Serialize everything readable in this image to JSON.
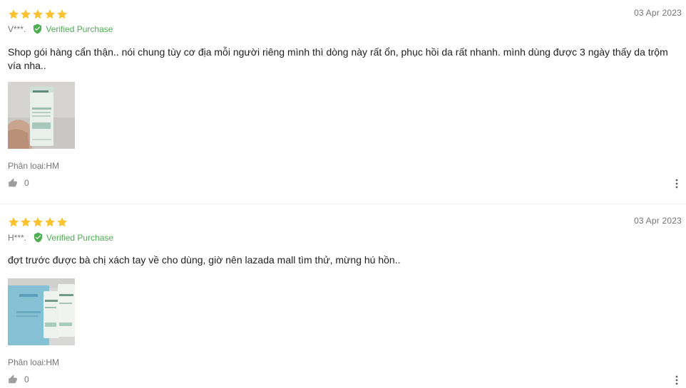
{
  "colors": {
    "star": "#f9c22e",
    "verified": "#4caf50",
    "meta": "#757575",
    "text": "#212121"
  },
  "reviews": [
    {
      "rating": 5,
      "date": "03 Apr 2023",
      "author": "V***.",
      "verified_label": "Verified Purchase",
      "text": "Shop gói hàng cẩn thận.. nói chung tùy cơ địa mỗi người riêng mình thì dòng này rất ổn, phục hồi da rất nhanh. mình dùng được 3 ngày thấy da trộm vía nha..",
      "photo_icon": "product-photo",
      "variant": "Phân loại:HM",
      "likes": "0"
    },
    {
      "rating": 5,
      "date": "03 Apr 2023",
      "author": "H***.",
      "verified_label": "Verified Purchase",
      "text": "đợt trước được bà chị xách tay về cho dùng, giờ nên lazada mall tìm thử, mừng hú hồn..",
      "photo_icon": "product-photo",
      "variant": "Phân loại:HM",
      "likes": "0"
    }
  ]
}
